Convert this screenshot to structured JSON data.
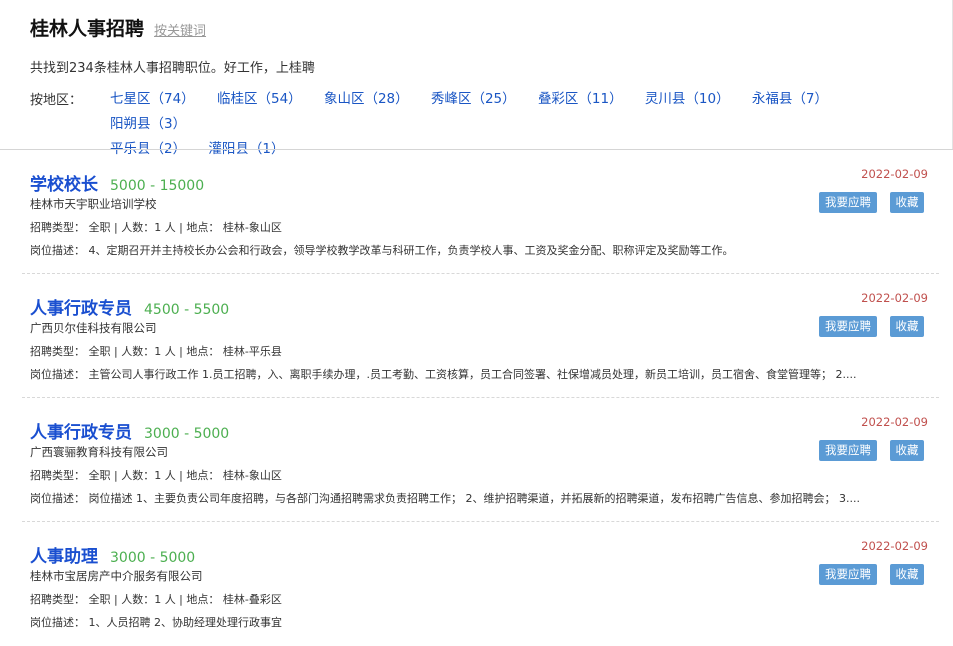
{
  "header": {
    "title": "桂林人事招聘",
    "keyword_link": "按关键词",
    "summary": "共找到234条桂林人事招聘职位。好工作，上桂聘",
    "region_label": "按地区：",
    "regions": [
      "七星区（74）",
      "临桂区（54）",
      "象山区（28）",
      "秀峰区（25）",
      "叠彩区（11）",
      "灵川县（10）",
      "永福县（7）",
      "阳朔县（3）",
      "平乐县（2）",
      "灌阳县（1）"
    ]
  },
  "labels": {
    "apply": "我要应聘",
    "favorite": "收藏"
  },
  "jobs": [
    {
      "title": "学校校长",
      "salary": "5000 - 15000",
      "company": "桂林市天宇职业培训学校",
      "meta": "招聘类型：  全职 | 人数：1 人 | 地点：  桂林-象山区",
      "desc": "岗位描述：  4、定期召开并主持校长办公会和行政会，领导学校教学改革与科研工作，负责学校人事、工资及奖金分配、职称评定及奖励等工作。",
      "date": "2022-02-09"
    },
    {
      "title": "人事行政专员",
      "salary": "4500 - 5500",
      "company": "广西贝尔佳科技有限公司",
      "meta": "招聘类型：  全职 | 人数：1 人 | 地点：  桂林-平乐县",
      "desc": "岗位描述：  主管公司人事行政工作 1.员工招聘，入、离职手续办理，.员工考勤、工资核算，员工合同签署、社保增减员处理，新员工培训，员工宿舍、食堂管理等；  2....",
      "date": "2022-02-09"
    },
    {
      "title": "人事行政专员",
      "salary": "3000 - 5000",
      "company": "广西寰骊教育科技有限公司",
      "meta": "招聘类型：  全职 | 人数：1 人 | 地点：  桂林-象山区",
      "desc": "岗位描述：  岗位描述 1、主要负责公司年度招聘，与各部门沟通招聘需求负责招聘工作；  2、维护招聘渠道，并拓展新的招聘渠道，发布招聘广告信息、参加招聘会；  3....",
      "date": "2022-02-09"
    },
    {
      "title": "人事助理",
      "salary": "3000 - 5000",
      "company": "桂林市宝居房产中介服务有限公司",
      "meta": "招聘类型：  全职 | 人数：1 人 | 地点：  桂林-叠彩区",
      "desc": "岗位描述：  1、人员招聘 2、协助经理处理行政事宜",
      "date": "2022-02-09"
    }
  ]
}
